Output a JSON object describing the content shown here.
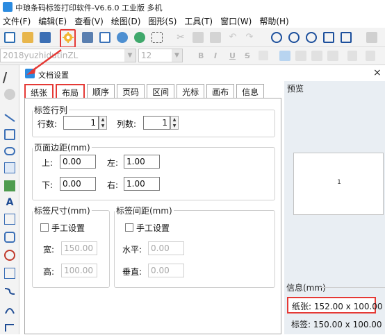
{
  "window": {
    "title": "中琅条码标签打印软件-V6.6.0 工业版 多机"
  },
  "menu": {
    "items": [
      "文件(F)",
      "编辑(E)",
      "查看(V)",
      "绘图(D)",
      "图形(S)",
      "工具(T)",
      "窗口(W)",
      "帮助(H)"
    ]
  },
  "format_toolbar": {
    "font_name": "2018yuzhidutinZL",
    "font_size": "12",
    "bold": "B",
    "italic": "I",
    "underline": "U",
    "strike": "S"
  },
  "dialog": {
    "title": "文档设置",
    "close": "×",
    "tabs": [
      "纸张",
      "布局",
      "顺序",
      "页码",
      "区间",
      "光标",
      "画布",
      "信息"
    ],
    "layout": {
      "rows_cols": {
        "legend": "标签行列",
        "rows_label": "行数:",
        "rows_value": "1",
        "cols_label": "列数:",
        "cols_value": "1"
      },
      "margins": {
        "legend": "页面边距(mm)",
        "top_label": "上:",
        "top_value": "0.00",
        "left_label": "左:",
        "left_value": "1.00",
        "bottom_label": "下:",
        "bottom_value": "0.00",
        "right_label": "右:",
        "right_value": "1.00"
      },
      "label_size": {
        "legend": "标签尺寸(mm)",
        "manual_label": "手工设置",
        "width_label": "宽:",
        "width_value": "150.00",
        "height_label": "高:",
        "height_value": "100.00"
      },
      "label_gap": {
        "legend": "标签间距(mm)",
        "manual_label": "手工设置",
        "h_label": "水平:",
        "h_value": "0.00",
        "v_label": "垂直:",
        "v_value": "0.00"
      }
    },
    "preview": {
      "title": "预览",
      "page_number": "1",
      "info_title": "信息(mm)",
      "paper": "纸张: 152.00 x 100.00",
      "label": "标签: 150.00 x 100.00"
    }
  },
  "colors": {
    "highlight": "#e53935",
    "accent": "#2b8be0"
  }
}
